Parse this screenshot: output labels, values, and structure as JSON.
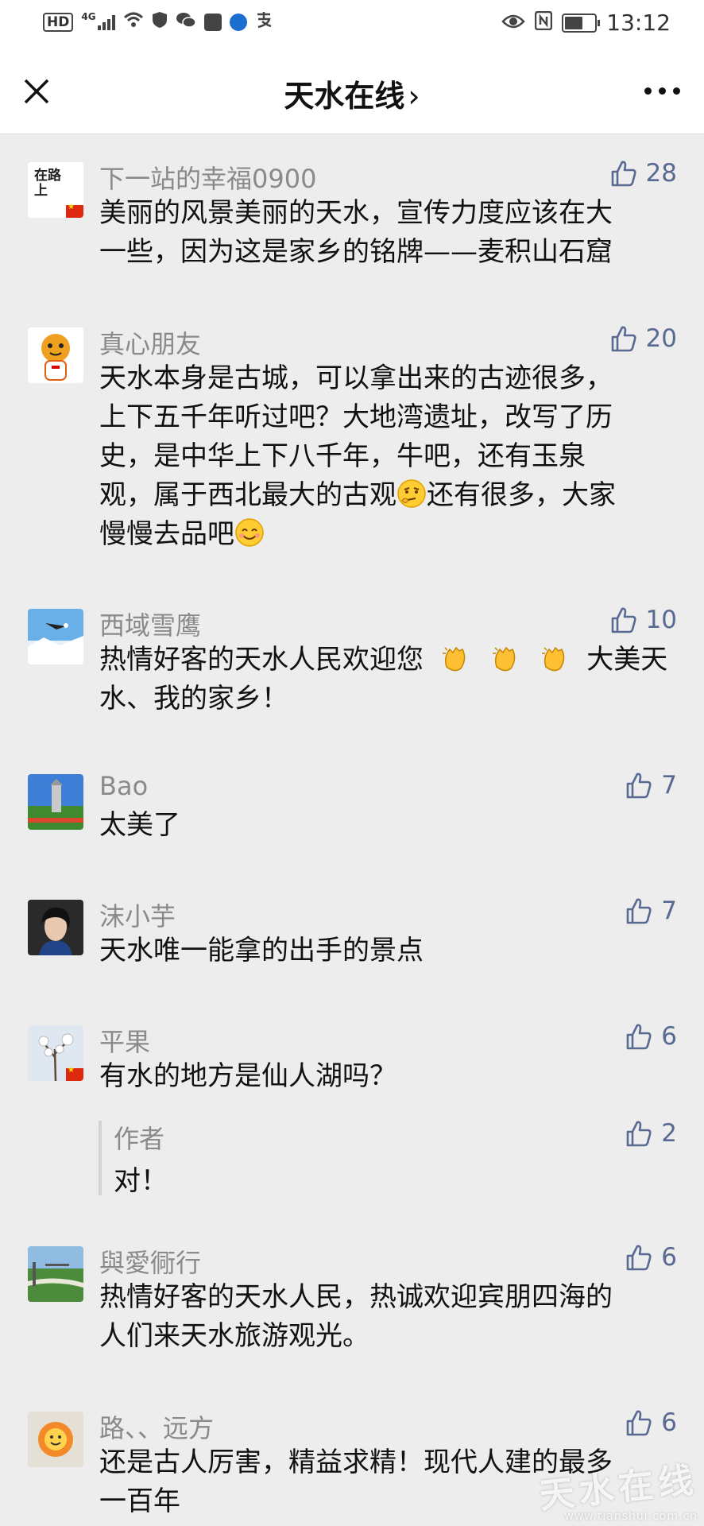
{
  "status_bar": {
    "hd": "HD",
    "network": "4G",
    "time": "13:12"
  },
  "nav": {
    "title": "天水在线",
    "title_arrow": "›"
  },
  "icons": {
    "close": "close-icon",
    "more": "more-icon",
    "like": "thumbs-up-icon"
  },
  "colors": {
    "like_blue": "#586a92",
    "background": "#ededed",
    "name_gray": "#8a8a8a"
  },
  "comments": [
    {
      "name": "下一站的幸福0900",
      "likes": "28",
      "text_lines": [
        "美丽的风景美丽的天水，宣传力度应该在大",
        "一些，因为这是家乡的铭牌——麦积山石窟"
      ]
    },
    {
      "name": "真心朋友",
      "likes": "20",
      "text_lines": [
        "天水本身是古城，可以拿出来的古迹很多，",
        "上下五千年听过吧？大地湾遗址，改写了历",
        "史，是中华上下八千年，牛吧，还有玉泉",
        "观，属于西北最大的古观",
        "还有很多，大家",
        "慢慢去品吧"
      ]
    },
    {
      "name": "西域雪鹰",
      "likes": "10",
      "text_lines": [
        "热情好客的天水人民欢迎您",
        "大美天",
        "水、我的家乡！"
      ]
    },
    {
      "name": "Bao",
      "likes": "7",
      "text_lines": [
        "太美了"
      ]
    },
    {
      "name": "沫小芋",
      "likes": "7",
      "text_lines": [
        "天水唯一能拿的出手的景点"
      ]
    },
    {
      "name": "平果",
      "likes": "6",
      "text_lines": [
        "有水的地方是仙人湖吗？"
      ],
      "reply": {
        "name": "作者",
        "likes": "2",
        "text": "对！"
      }
    },
    {
      "name": "與愛衕行",
      "likes": "6",
      "text_lines": [
        "热情好客的天水人民，热诚欢迎宾朋四海的",
        "人们来天水旅游观光。"
      ]
    },
    {
      "name": "路、、远方",
      "likes": "6",
      "text_lines": [
        "还是古人厉害，精益求精！现代人建的最多",
        "一百年"
      ]
    }
  ],
  "avatar_texts": {
    "first": "在路上"
  },
  "watermark": {
    "text": "天水在线",
    "url": "www.tianshui.com.cn"
  }
}
